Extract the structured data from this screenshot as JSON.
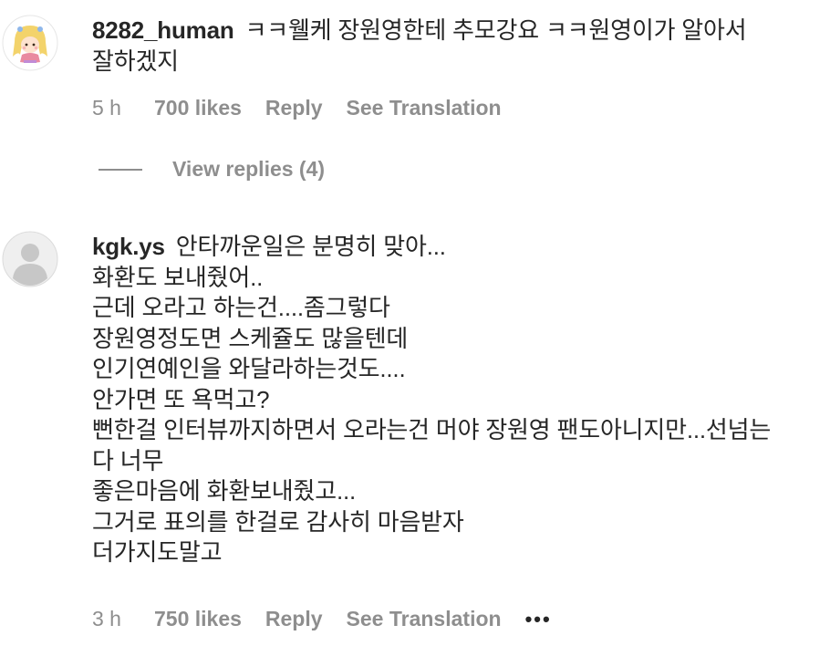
{
  "comments": [
    {
      "username": "8282_human",
      "text": "ㅋㅋ웰케 장원영한테 추모강요 ㅋㅋ원영이가 알아서\n잘하겠지",
      "time": "5 h",
      "likes": "700 likes",
      "reply_label": "Reply",
      "translate_label": "See Translation",
      "avatar_icon": "cartoon-girl-avatar",
      "view_replies": "View replies (4)"
    },
    {
      "username": "kgk.ys",
      "text": "안타까운일은 분명히 맞아...\n화환도 보내줬어..\n근데 오라고 하는건....좀그렇다\n장원영정도면 스케쥴도 많을텐데\n인기연예인을 와달라하는것도....\n안가면 또 욕먹고?\n뻔한걸 인터뷰까지하면서 오라는건 머야 장원영 팬도아니지만...선넘는\n다 너무\n좋은마음에 화환보내줬고...\n그거로 표의를 한걸로 감사히 마음받자\n더가지도말고",
      "time": "3 h",
      "likes": "750 likes",
      "reply_label": "Reply",
      "translate_label": "See Translation",
      "more_label": "•••",
      "avatar_icon": "default-user-avatar"
    }
  ]
}
